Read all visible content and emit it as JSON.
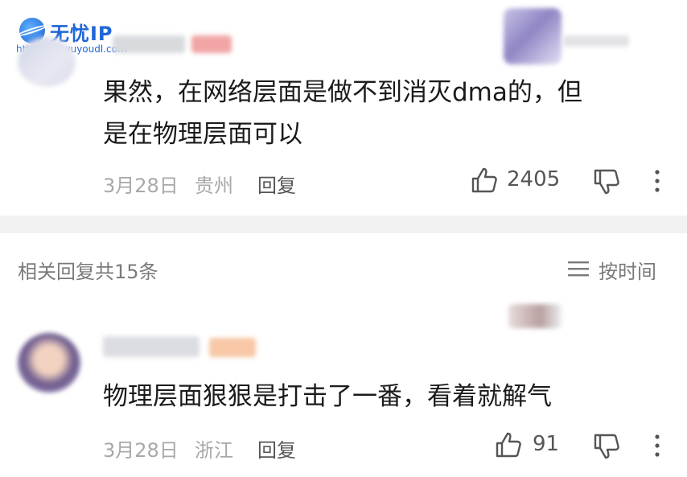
{
  "watermark": {
    "title": "无忧IP",
    "url": "https://ip.wuyoudl.com"
  },
  "comment_1": {
    "text_line_1": "果然，在网络层面是做不到消灭dma的，但",
    "text_line_2": "是在物理层面可以",
    "date": "3月28日",
    "location": "贵州",
    "reply_label": "回复",
    "like_count": "2405",
    "icons": [
      "thumbs-up-icon",
      "thumbs-down-icon",
      "more-icon"
    ]
  },
  "replies_header": {
    "count_label": "相关回复共15条",
    "sort_label": "按时间",
    "sort_icon": "list-sort-icon"
  },
  "comment_2": {
    "text": "物理层面狠狠是打击了一番，看着就解气",
    "date": "3月28日",
    "location": "浙江",
    "reply_label": "回复",
    "like_count": "91",
    "icons": [
      "thumbs-up-icon",
      "thumbs-down-icon",
      "more-icon"
    ]
  },
  "colors": {
    "watermark_blue": "#1f66d8",
    "text": "#1b1b1b",
    "meta_gray": "#a8a8a8",
    "divider": "#f2f2f2"
  }
}
